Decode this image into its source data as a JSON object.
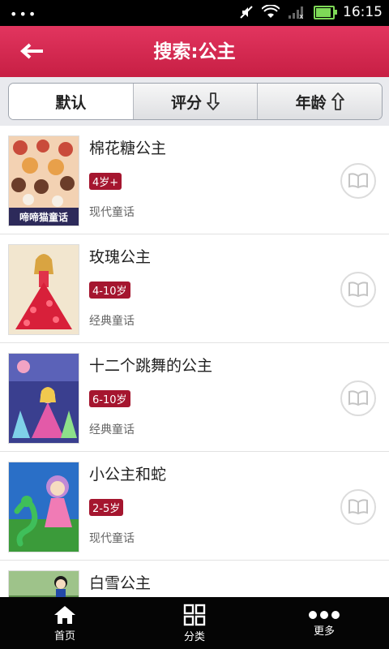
{
  "status": {
    "time": "16:15"
  },
  "header": {
    "title": "搜索:公主"
  },
  "filters": [
    {
      "label": "默认",
      "icon": "none"
    },
    {
      "label": "评分",
      "icon": "arrow-down-icon"
    },
    {
      "label": "年龄",
      "icon": "arrow-up-icon"
    }
  ],
  "items": [
    {
      "name": "棉花糖公主",
      "age": "4岁+",
      "category": "现代童话",
      "cover_text": "啼啼猫童话"
    },
    {
      "name": "玫瑰公主",
      "age": "4-10岁",
      "category": "经典童话"
    },
    {
      "name": "十二个跳舞的公主",
      "age": "6-10岁",
      "category": "经典童话"
    },
    {
      "name": "小公主和蛇",
      "age": "2-5岁",
      "category": "现代童话"
    },
    {
      "name": "白雪公主"
    }
  ],
  "nav": [
    {
      "label": "首页",
      "icon": "home-icon"
    },
    {
      "label": "分类",
      "icon": "grid-icon"
    },
    {
      "label": "更多",
      "icon": "more-icon"
    }
  ],
  "colors": {
    "header": "#d2284f",
    "badge": "#a5162f",
    "nav_bg": "#050505"
  }
}
